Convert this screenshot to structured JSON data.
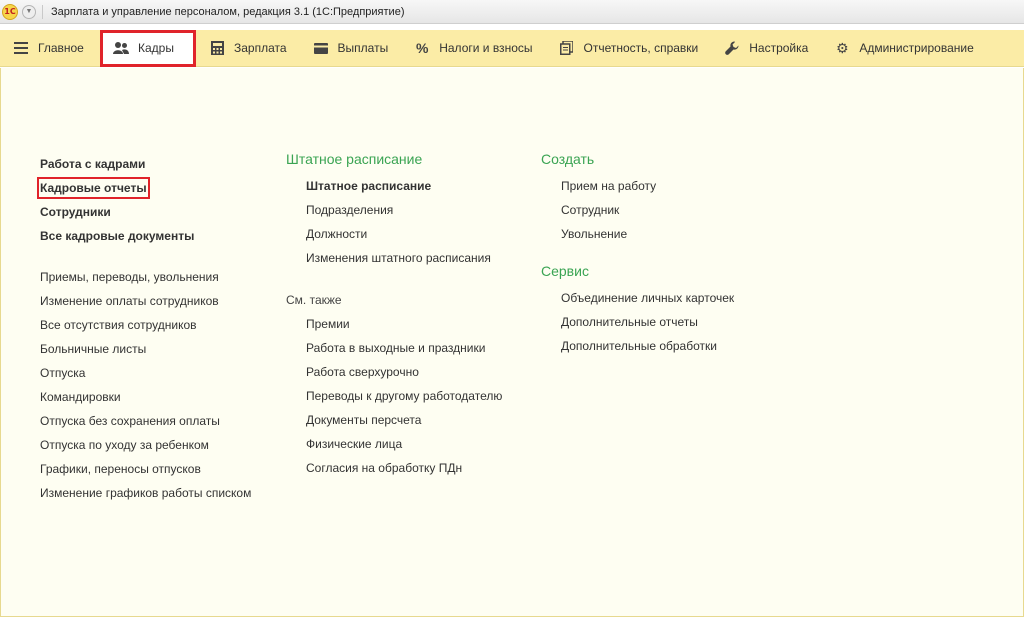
{
  "window": {
    "logo": "1С",
    "title": "Зарплата и управление персоналом, редакция 3.1  (1С:Предприятие)"
  },
  "sections": [
    {
      "label": "Главное",
      "icon": "hamburger-icon"
    },
    {
      "label": "Кадры",
      "icon": "users-icon"
    },
    {
      "label": "Зарплата",
      "icon": "calculator-icon"
    },
    {
      "label": "Выплаты",
      "icon": "wallet-icon"
    },
    {
      "label": "Налоги и взносы",
      "icon": "percent-icon"
    },
    {
      "label": "Отчетность, справки",
      "icon": "reports-icon"
    },
    {
      "label": "Настройка",
      "icon": "wrench-icon"
    },
    {
      "label": "Администрирование",
      "icon": "gear-icon"
    }
  ],
  "left_column": {
    "main_links": [
      "Работа с кадрами",
      "Кадровые отчеты",
      "Сотрудники",
      "Все кадровые документы"
    ],
    "links": [
      "Приемы, переводы, увольнения",
      "Изменение оплаты сотрудников",
      "Все отсутствия сотрудников",
      "Больничные листы",
      "Отпуска",
      "Командировки",
      "Отпуска без сохранения оплаты",
      "Отпуска по уходу за ребенком",
      "Графики, переносы отпусков",
      "Изменение графиков работы списком"
    ]
  },
  "middle_column": {
    "group_title": "Штатное расписание",
    "links": [
      "Штатное расписание",
      "Подразделения",
      "Должности",
      "Изменения штатного расписания"
    ],
    "see_also_label": "См. также",
    "see_also_links": [
      "Премии",
      "Работа в выходные и праздники",
      "Работа сверхурочно",
      "Переводы к другому работодателю",
      "Документы персчета",
      "Физические лица",
      "Согласия на обработку ПДн"
    ]
  },
  "right_column": {
    "create_title": "Создать",
    "create_links": [
      "Прием на работу",
      "Сотрудник",
      "Увольнение"
    ],
    "service_title": "Сервис",
    "service_links": [
      "Объединение личных карточек",
      "Дополнительные отчеты",
      "Дополнительные обработки"
    ]
  },
  "colors": {
    "section_panel": "#fbeca6",
    "content_bg": "#fefef2",
    "group_title": "#3aa453",
    "highlight": "#e0232a"
  }
}
